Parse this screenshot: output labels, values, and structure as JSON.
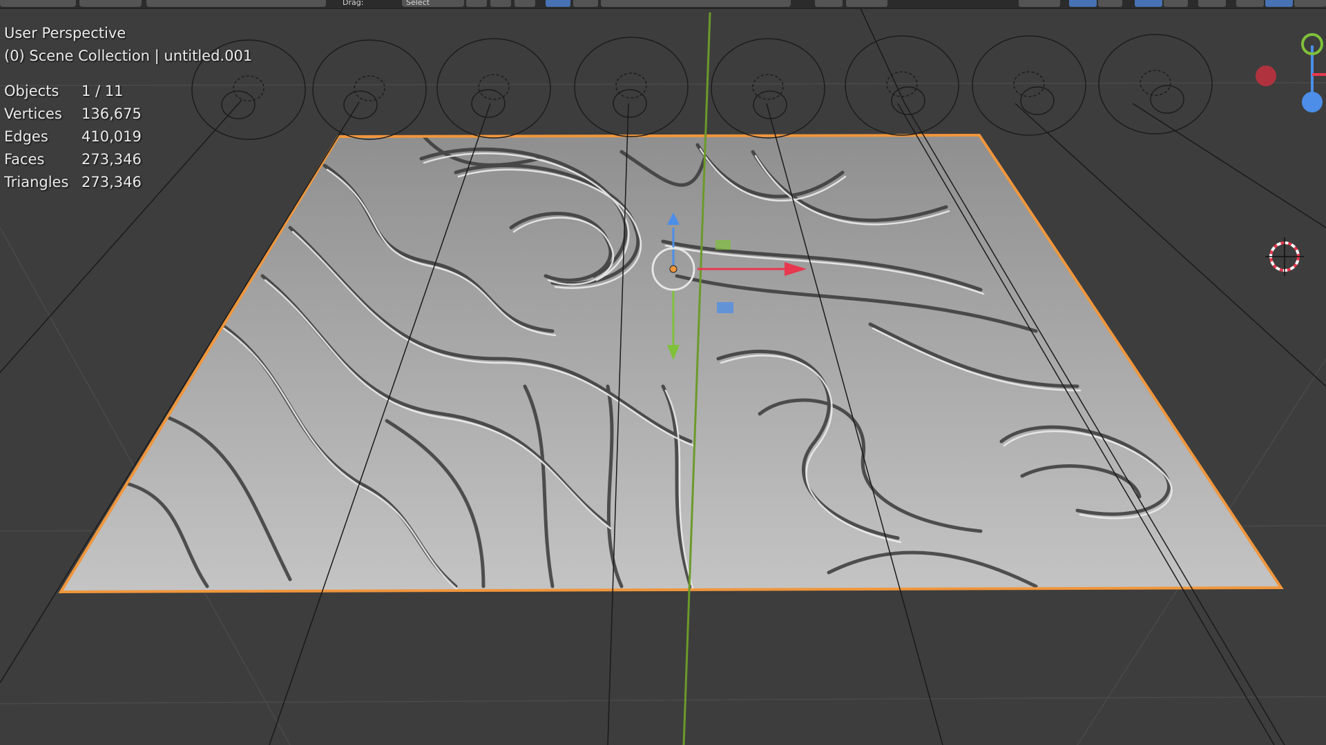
{
  "viewport": {
    "view_name": "User Perspective",
    "collection_info": "(0) Scene Collection | untitled.001"
  },
  "statistics": [
    {
      "label": "Objects",
      "value": "1 / 11"
    },
    {
      "label": "Vertices",
      "value": "136,675"
    },
    {
      "label": "Edges",
      "value": "410,019"
    },
    {
      "label": "Faces",
      "value": "273,346"
    },
    {
      "label": "Triangles",
      "value": "273,346"
    }
  ],
  "header": {
    "drag_label": "Drag:",
    "drag_value": "Select"
  },
  "colors": {
    "background": "#3d3d3d",
    "selection_outline": "#f0963c",
    "axis_x": "#e8384f",
    "axis_y": "#7fc13b",
    "axis_z": "#4c8ee8",
    "y_axis_line": "#6c9a2a"
  },
  "icons": {
    "gizmo": "navigation-gizmo-icon",
    "cursor": "3d-cursor-icon",
    "transform": "transform-gizmo-icon"
  }
}
